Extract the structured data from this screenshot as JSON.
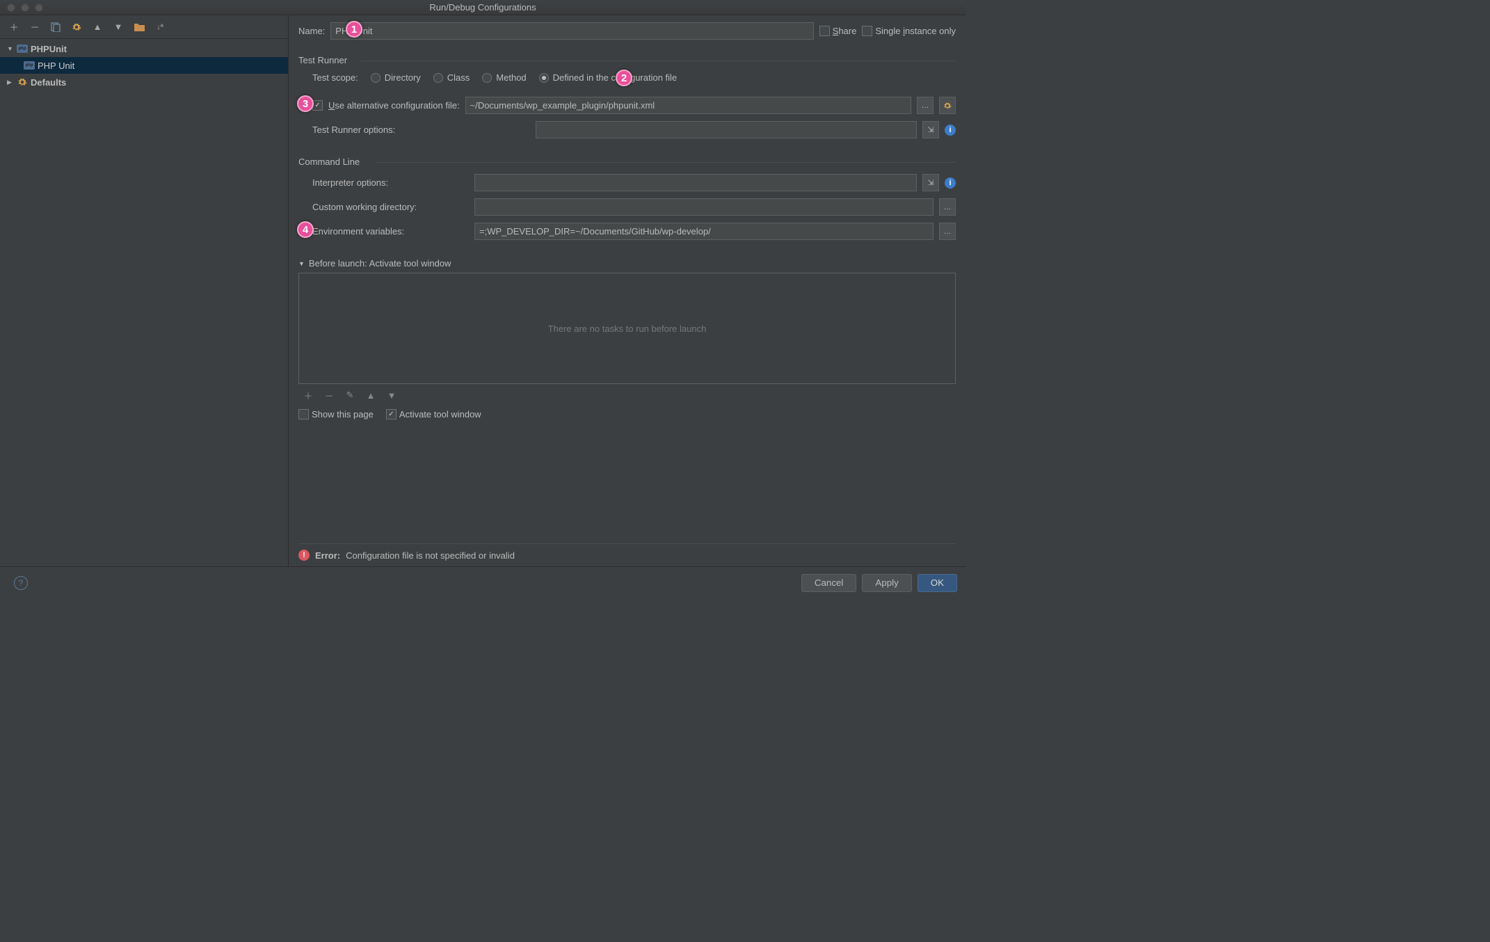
{
  "window": {
    "title": "Run/Debug Configurations"
  },
  "tree": {
    "cat_phpunit": "PHPUnit",
    "run_cfg": "PHP Unit",
    "defaults": "Defaults"
  },
  "name": {
    "label": "Name:",
    "value": "PHP Unit",
    "share": "Share",
    "single": "Single instance only"
  },
  "test_runner": {
    "section": "Test Runner",
    "scope_label": "Test scope:",
    "opt_directory": "Directory",
    "opt_class": "Class",
    "opt_method": "Method",
    "opt_configfile": "Defined in the configuration file",
    "use_alt_cfg": "Use alternative configuration file:",
    "alt_cfg_value": "~/Documents/wp_example_plugin/phpunit.xml",
    "runner_options_label": "Test Runner options:",
    "runner_options_value": ""
  },
  "command_line": {
    "section": "Command Line",
    "interpreter_label": "Interpreter options:",
    "interpreter_value": "",
    "cwd_label": "Custom working directory:",
    "cwd_value": "",
    "env_label": "Environment variables:",
    "env_value": "=;WP_DEVELOP_DIR=~/Documents/GitHub/wp-develop/"
  },
  "before_launch": {
    "header": "Before launch: Activate tool window",
    "empty": "There are no tasks to run before launch",
    "show_page": "Show this page",
    "activate_tool": "Activate tool window"
  },
  "error": {
    "label": "Error:",
    "msg": "Configuration file is not specified or invalid"
  },
  "buttons": {
    "cancel": "Cancel",
    "apply": "Apply",
    "ok": "OK"
  },
  "annotations": {
    "a1": "1",
    "a2": "2",
    "a3": "3",
    "a4": "4"
  }
}
